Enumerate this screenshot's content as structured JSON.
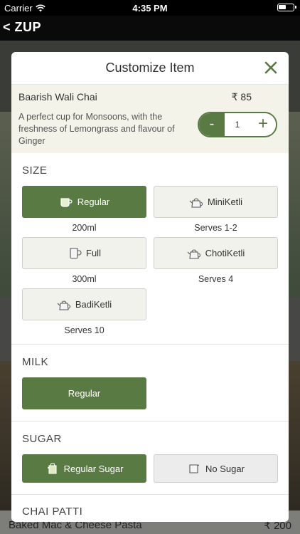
{
  "status_bar": {
    "carrier": "Carrier",
    "time": "4:35 PM"
  },
  "nav": {
    "back_label": "< ZUP"
  },
  "background": {
    "bottom_item_title": "Baked Mac & Cheese Pasta",
    "bottom_item_price": "₹ 200"
  },
  "modal": {
    "title": "Customize Item",
    "item": {
      "name": "Baarish Wali Chai",
      "price": "₹ 85",
      "description": "A perfect cup for Monsoons, with the freshness of Lemongrass and flavour of Ginger",
      "quantity": "1",
      "minus_label": "-",
      "plus_label": "+"
    },
    "sections": {
      "size": {
        "title": "SIZE",
        "options": [
          {
            "label": "Regular",
            "sub": "200ml",
            "icon": "cup-icon",
            "selected": true
          },
          {
            "label": "MiniKetli",
            "sub": "Serves 1-2",
            "icon": "kettle-icon",
            "selected": false
          },
          {
            "label": "Full",
            "sub": "300ml",
            "icon": "mug-icon",
            "selected": false
          },
          {
            "label": "ChotiKetli",
            "sub": "Serves 4",
            "icon": "kettle-icon",
            "selected": false
          },
          {
            "label": "BadiKetli",
            "sub": "Serves 10",
            "icon": "kettle-icon",
            "selected": false
          }
        ]
      },
      "milk": {
        "title": "MILK",
        "options": [
          {
            "label": "Regular",
            "selected": true
          }
        ]
      },
      "sugar": {
        "title": "SUGAR",
        "options": [
          {
            "label": "Regular Sugar",
            "icon": "sugar-icon",
            "selected": true
          },
          {
            "label": "No Sugar",
            "icon": "no-sugar-icon",
            "selected": false
          }
        ]
      },
      "chai_patti": {
        "title": "CHAI PATTI"
      }
    }
  },
  "colors": {
    "accent": "#5a7a44",
    "panel": "#f3f3ea"
  }
}
